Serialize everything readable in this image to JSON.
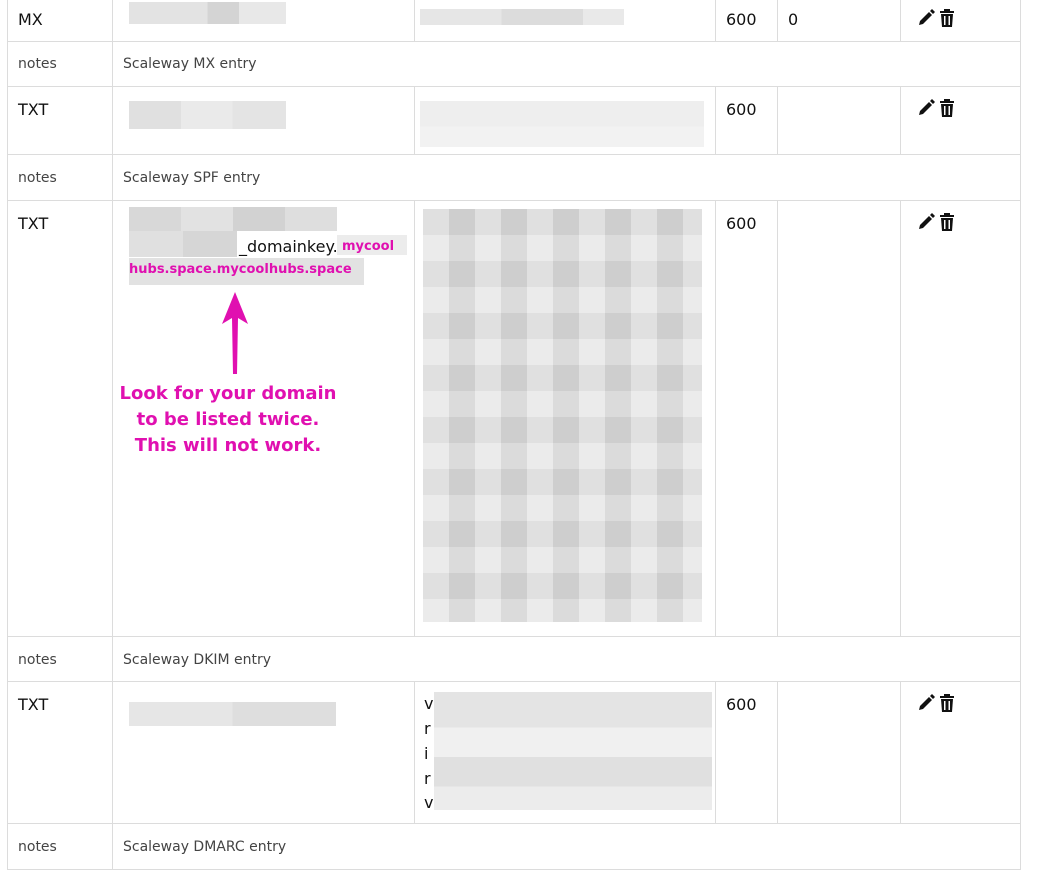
{
  "records": [
    {
      "type": "MX",
      "ttl": "600",
      "priority": "0",
      "note_label": "notes",
      "note": "Scaleway MX entry"
    },
    {
      "type": "TXT",
      "ttl": "600",
      "priority": "",
      "note_label": "notes",
      "note": "Scaleway SPF entry"
    },
    {
      "type": "TXT",
      "ttl": "600",
      "priority": "",
      "note_label": "notes",
      "note": "Scaleway DKIM entry"
    },
    {
      "type": "TXT",
      "ttl": "600",
      "priority": "",
      "note_label": "notes",
      "note": "Scaleway DMARC entry"
    }
  ],
  "dkim_name": {
    "suffix": "_domainkey.",
    "highlight_line1": "mycool",
    "highlight_line2": "hubs.space.mycoolhubs.space"
  },
  "dmarc_value_letters": [
    "v",
    "r",
    "i",
    "r",
    "v"
  ],
  "annotation": {
    "line1": "Look for your domain",
    "line2": "to be listed twice.",
    "line3": "This will not work.",
    "color": "#e010b0"
  },
  "icons": [
    "pencil-icon",
    "trash-icon"
  ]
}
